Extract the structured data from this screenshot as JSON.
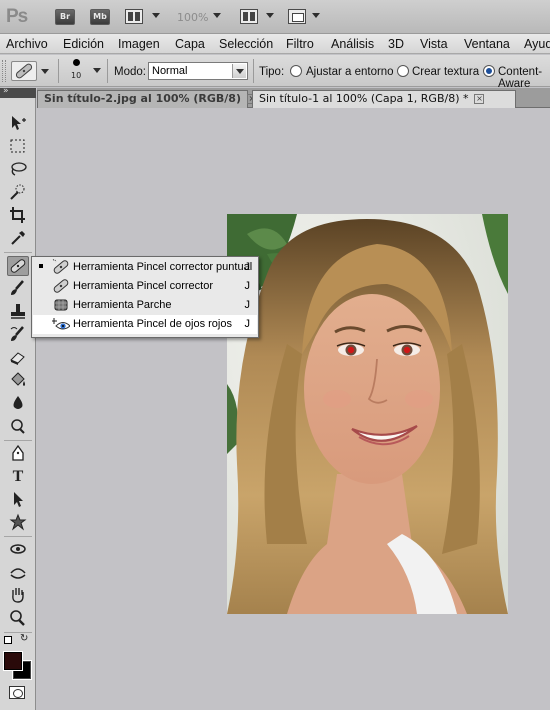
{
  "app": {
    "logo": "Ps",
    "bridge_label": "Br",
    "minibridge_label": "Mb",
    "zoom": "100%"
  },
  "menu": [
    "Archivo",
    "Edición",
    "Imagen",
    "Capa",
    "Selección",
    "Filtro",
    "Análisis",
    "3D",
    "Vista",
    "Ventana",
    "Ayuda"
  ],
  "options": {
    "brush_size": "10",
    "mode_label": "Modo:",
    "mode_value": "Normal",
    "type_label": "Tipo:",
    "radio_1": "Ajustar a entorno",
    "radio_2": "Crear textura",
    "radio_3": "Content-Aware",
    "selected_type": "Content-Aware"
  },
  "tabs": [
    {
      "label": "Sin título-2.jpg al 100% (RGB/8)",
      "active": false
    },
    {
      "label": "Sin título-1 al 100% (Capa 1, RGB/8) *",
      "active": true
    }
  ],
  "flyout": {
    "items": [
      {
        "label": "Herramienta Pincel corrector puntual",
        "key": "J",
        "icon": "spot-healing-brush-icon",
        "current": true
      },
      {
        "label": "Herramienta Pincel corrector",
        "key": "J",
        "icon": "healing-brush-icon",
        "current": false
      },
      {
        "label": "Herramienta Parche",
        "key": "J",
        "icon": "patch-icon",
        "current": false
      },
      {
        "label": "Herramienta Pincel de ojos rojos",
        "key": "J",
        "icon": "red-eye-icon",
        "current": false
      }
    ]
  },
  "tools": [
    "move-icon",
    "marquee-icon",
    "lasso-icon",
    "quick-selection-icon",
    "crop-icon",
    "eyedropper-icon",
    "spot-healing-icon",
    "brush-icon",
    "clone-stamp-icon",
    "history-brush-icon",
    "eraser-icon",
    "paint-bucket-icon",
    "blur-icon",
    "dodge-icon",
    "pen-icon",
    "type-icon",
    "path-selection-icon",
    "shape-icon",
    "3d-rotate-icon",
    "3d-orbit-icon",
    "hand-icon",
    "zoom-icon"
  ],
  "colors": {
    "foreground": "#2a0a0a",
    "background": "#000000",
    "canvas": "#c3c2c6",
    "accent": "#1d4f9a"
  }
}
